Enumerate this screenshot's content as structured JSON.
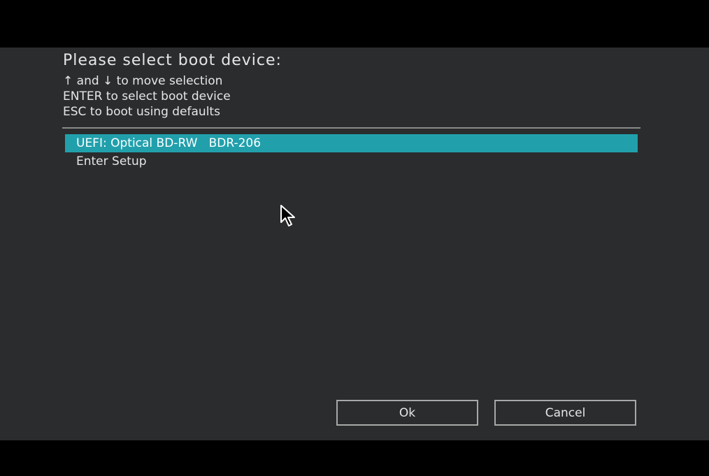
{
  "dialog": {
    "title": "Please select boot device:",
    "instructions": [
      "↑ and ↓ to move selection",
      "ENTER to select boot device",
      "ESC to boot using defaults"
    ]
  },
  "devices": [
    {
      "label": "UEFI: Optical BD-RW   BDR-206",
      "selected": true
    },
    {
      "label": "Enter Setup",
      "selected": false
    }
  ],
  "buttons": {
    "ok_label": "Ok",
    "cancel_label": "Cancel"
  },
  "colors": {
    "background": "#000000",
    "panel": "#2b2c2e",
    "selection": "#21a0ac",
    "text": "#e6e6e6"
  },
  "icons": {
    "cursor": "mouse-pointer-icon"
  }
}
